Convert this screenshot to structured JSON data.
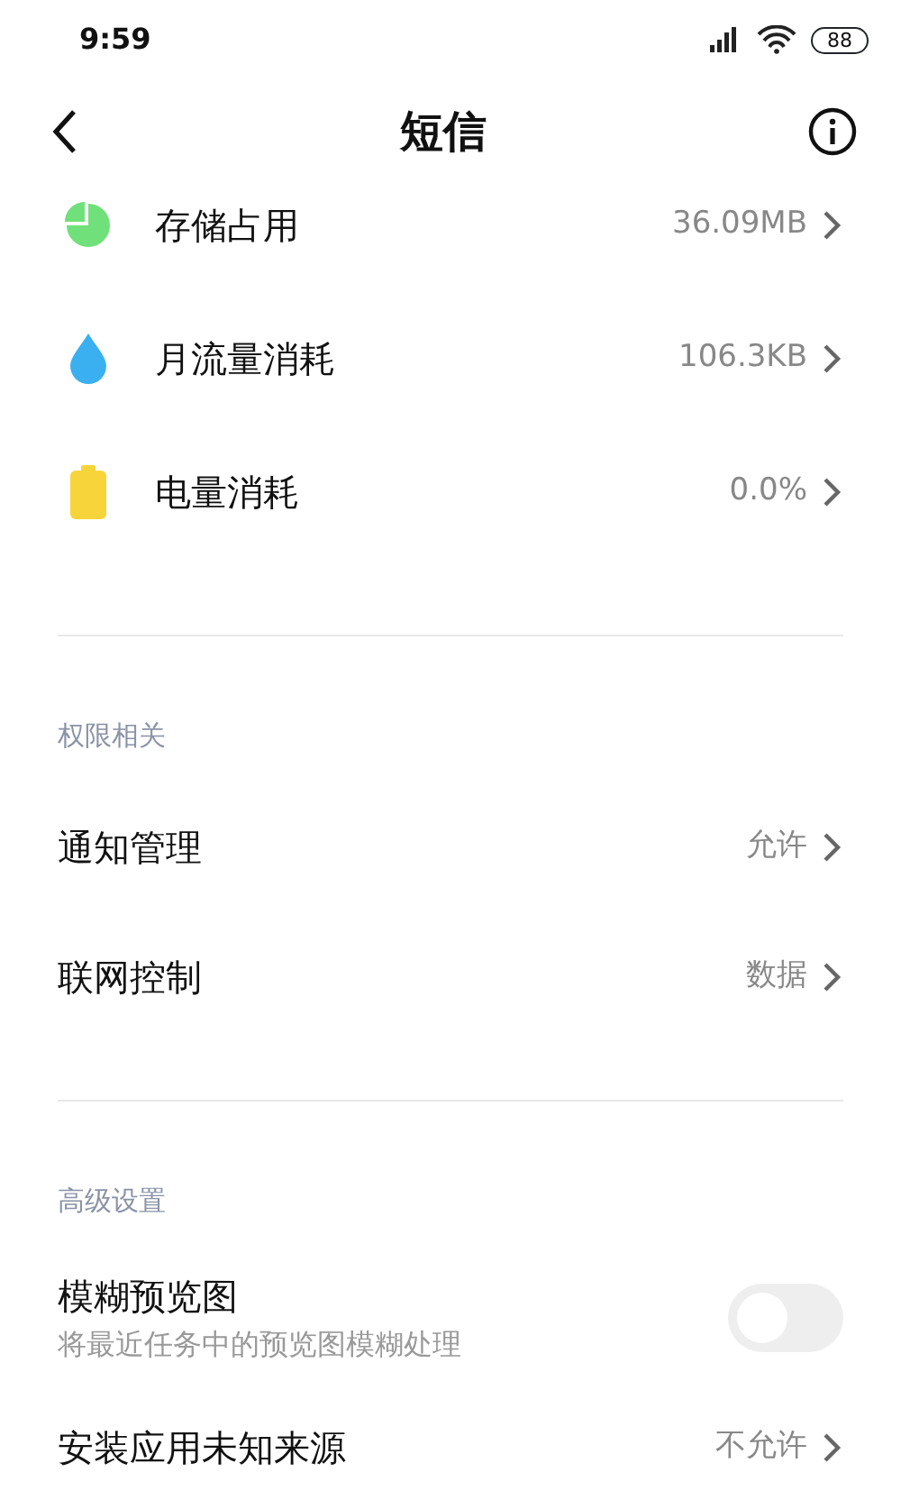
{
  "status_bar": {
    "time": "9:59",
    "battery": "88"
  },
  "header": {
    "title": "短信"
  },
  "usage": [
    {
      "label": "存储占用",
      "value": "36.09MB"
    },
    {
      "label": "月流量消耗",
      "value": "106.3KB"
    },
    {
      "label": "电量消耗",
      "value": "0.0%"
    }
  ],
  "sections": [
    {
      "title": "权限相关",
      "items": [
        {
          "kind": "nav",
          "label": "通知管理",
          "value": "允许"
        },
        {
          "kind": "nav",
          "label": "联网控制",
          "value": "数据"
        }
      ]
    },
    {
      "title": "高级设置",
      "items": [
        {
          "kind": "toggle",
          "label": "模糊预览图",
          "subtitle": "将最近任务中的预览图模糊处理",
          "on": false
        },
        {
          "kind": "nav",
          "label": "安装应用未知来源",
          "value": "不允许"
        }
      ]
    }
  ]
}
